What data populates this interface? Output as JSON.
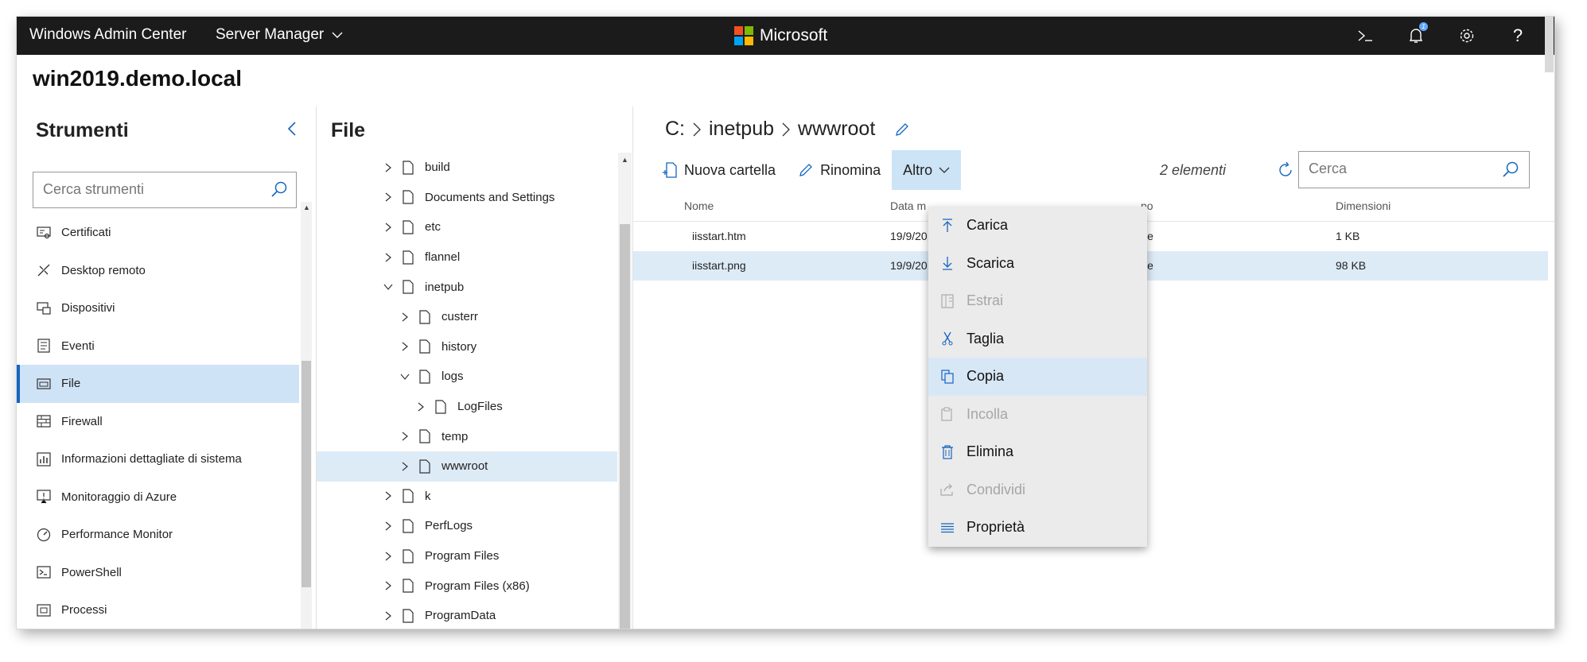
{
  "app": {
    "title": "Windows Admin Center",
    "server_manager": "Server Manager",
    "brand": "Microsoft",
    "notification_count": "1"
  },
  "hostname": "win2019.demo.local",
  "colors": {
    "topbar": "#1b1b1b",
    "accent": "#1565c0",
    "selected": "#cfe3f6"
  },
  "sidebar": {
    "title": "Strumenti",
    "search_placeholder": "Cerca strumenti",
    "items": [
      {
        "label": "Certificati",
        "icon": "certificate-icon"
      },
      {
        "label": "Desktop remoto",
        "icon": "remote-desktop-icon"
      },
      {
        "label": "Dispositivi",
        "icon": "devices-icon"
      },
      {
        "label": "Eventi",
        "icon": "events-icon"
      },
      {
        "label": "File",
        "icon": "files-icon"
      },
      {
        "label": "Firewall",
        "icon": "firewall-icon"
      },
      {
        "label": "Informazioni dettagliate di sistema",
        "icon": "system-insights-icon"
      },
      {
        "label": "Monitoraggio di Azure",
        "icon": "azure-monitor-icon"
      },
      {
        "label": "Performance Monitor",
        "icon": "performance-icon"
      },
      {
        "label": "PowerShell",
        "icon": "powershell-icon"
      },
      {
        "label": "Processi",
        "icon": "processes-icon"
      }
    ]
  },
  "tree": {
    "title": "File",
    "nodes": [
      {
        "label": "build"
      },
      {
        "label": "Documents and Settings"
      },
      {
        "label": "etc"
      },
      {
        "label": "flannel"
      },
      {
        "label": "inetpub"
      },
      {
        "label": "custerr"
      },
      {
        "label": "history"
      },
      {
        "label": "logs"
      },
      {
        "label": "LogFiles"
      },
      {
        "label": "temp"
      },
      {
        "label": "wwwroot"
      },
      {
        "label": "k"
      },
      {
        "label": "PerfLogs"
      },
      {
        "label": "Program Files"
      },
      {
        "label": "Program Files (x86)"
      },
      {
        "label": "ProgramData"
      }
    ]
  },
  "main": {
    "breadcrumb": [
      "C:",
      "inetpub",
      "wwwroot"
    ],
    "toolbar": {
      "new_folder": "Nuova cartella",
      "rename": "Rinomina",
      "more": "Altro"
    },
    "item_count": "2 elementi",
    "search_placeholder": "Cerca",
    "columns": {
      "name": "Nome",
      "date": "Data m",
      "type": "po",
      "size": "Dimensioni"
    },
    "rows": [
      {
        "name": "iisstart.htm",
        "date": "19/9/20",
        "type": "le",
        "size": "1 KB"
      },
      {
        "name": "iisstart.png",
        "date": "19/9/20",
        "type": "le",
        "size": "98 KB"
      }
    ]
  },
  "menu": {
    "items": [
      {
        "label": "Carica",
        "icon": "upload-icon",
        "enabled": true
      },
      {
        "label": "Scarica",
        "icon": "download-icon",
        "enabled": true
      },
      {
        "label": "Estrai",
        "icon": "extract-icon",
        "enabled": false
      },
      {
        "label": "Taglia",
        "icon": "cut-icon",
        "enabled": true
      },
      {
        "label": "Copia",
        "icon": "copy-icon",
        "enabled": true
      },
      {
        "label": "Incolla",
        "icon": "paste-icon",
        "enabled": false
      },
      {
        "label": "Elimina",
        "icon": "delete-icon",
        "enabled": true
      },
      {
        "label": "Condividi",
        "icon": "share-icon",
        "enabled": false
      },
      {
        "label": "Proprietà",
        "icon": "properties-icon",
        "enabled": true
      }
    ]
  }
}
